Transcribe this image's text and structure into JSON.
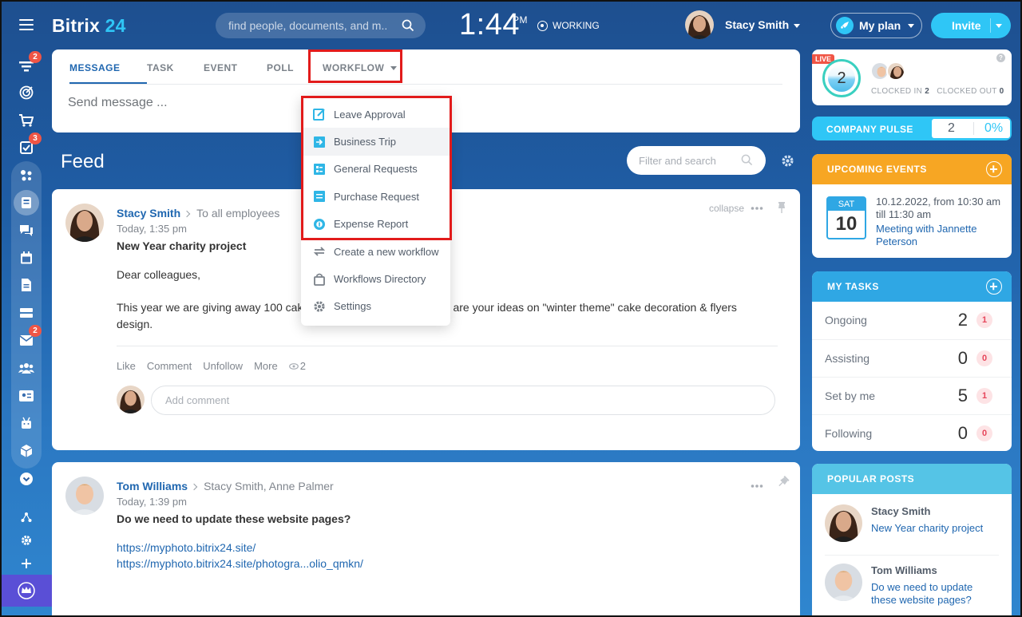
{
  "app": {
    "name": "Bitrix",
    "name_num": "24"
  },
  "header": {
    "search_placeholder": "find people, documents, and m...",
    "time": "1:44",
    "ampm": "PM",
    "status": "WORKING",
    "user_name": "Stacy Smith",
    "plan_label": "My plan",
    "invite_label": "Invite"
  },
  "sidebar": {
    "badges": {
      "feed": "2",
      "tasks": "3",
      "mail": "2"
    }
  },
  "composer": {
    "tabs": [
      {
        "label": "MESSAGE"
      },
      {
        "label": "TASK"
      },
      {
        "label": "EVENT"
      },
      {
        "label": "POLL"
      },
      {
        "label": "WORKFLOW"
      }
    ],
    "placeholder": "Send message ..."
  },
  "workflow_menu": {
    "items": [
      {
        "label": "Leave Approval",
        "icon": "edit-doc-icon"
      },
      {
        "label": "Business Trip",
        "icon": "trip-doc-icon"
      },
      {
        "label": "General Requests",
        "icon": "request-doc-icon"
      },
      {
        "label": "Purchase Request",
        "icon": "purchase-doc-icon"
      },
      {
        "label": "Expense Report",
        "icon": "expense-icon"
      },
      {
        "label": "Create a new workflow",
        "icon": "refresh-icon"
      },
      {
        "label": "Workflows Directory",
        "icon": "bag-icon"
      },
      {
        "label": "Settings",
        "icon": "gear-icon"
      }
    ]
  },
  "feed": {
    "title": "Feed",
    "filter_placeholder": "Filter and search",
    "posts": [
      {
        "author": "Stacy Smith",
        "recipients": "To all employees",
        "time": "Today, 1:35 pm",
        "title": "New Year charity project",
        "collapse": "collapse",
        "greeting": "Dear colleagues,",
        "body_start": "This year we are giving away 100 cak",
        "body_end": "are your ideas on \"winter theme\" cake decoration & flyers",
        "body_line2": "design.",
        "actions": {
          "like": "Like",
          "comment": "Comment",
          "unfollow": "Unfollow",
          "more": "More",
          "views": "2"
        },
        "comment_placeholder": "Add comment"
      },
      {
        "author": "Tom Williams",
        "recipients": "Stacy Smith, Anne Palmer",
        "time": "Today, 1:39 pm",
        "title": "Do we need to update these website pages?",
        "links": [
          "https://myphoto.bitrix24.site/",
          "https://myphoto.bitrix24.site/photogra...olio_qmkn/"
        ]
      }
    ]
  },
  "timeman": {
    "live": "LIVE",
    "count": "2",
    "clocked_in_label": "CLOCKED IN",
    "clocked_in": "2",
    "clocked_out_label": "CLOCKED OUT",
    "clocked_out": "0",
    "help": "?"
  },
  "pulse": {
    "label": "COMPANY PULSE",
    "value": "2",
    "percent": "0%"
  },
  "events": {
    "title": "UPCOMING EVENTS",
    "day_name": "SAT",
    "day_num": "10",
    "when": "10.12.2022, from 10:30 am till 11:30 am",
    "name": "Meeting with Jannette Peterson"
  },
  "tasks": {
    "title": "MY TASKS",
    "rows": [
      {
        "label": "Ongoing",
        "count": "2",
        "badge": "1"
      },
      {
        "label": "Assisting",
        "count": "0",
        "badge": "0"
      },
      {
        "label": "Set by me",
        "count": "5",
        "badge": "1"
      },
      {
        "label": "Following",
        "count": "0",
        "badge": "0"
      }
    ]
  },
  "popular": {
    "title": "POPULAR POSTS",
    "items": [
      {
        "author": "Stacy Smith",
        "title": "New Year charity project"
      },
      {
        "author": "Tom Williams",
        "title": "Do we need to update these website pages?"
      }
    ]
  },
  "colors": {
    "accent": "#2067b0",
    "cyan": "#2fc6f6",
    "highlight_red": "#e21b1b",
    "events_orange": "#f7a623",
    "tasks_blue": "#2fa7e4"
  }
}
